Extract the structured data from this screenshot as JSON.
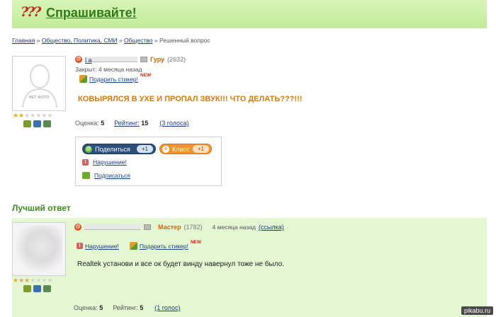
{
  "header": {
    "logo_mark": "???",
    "title": "Спрашивайте!"
  },
  "breadcrumb": {
    "items": [
      "Главная",
      "Общество, Политика, СМИ",
      "Общество"
    ],
    "separator": "»",
    "current": "Решенный вопрос"
  },
  "question": {
    "avatar_caption": "НЕТ ФОТО",
    "stars_filled": 2,
    "stars_total": 7,
    "user_name": "l                 а",
    "rank": "Гуру",
    "points": "(2632)",
    "closed": "Закрыт: 4 месяца назад",
    "gift_label": "Подарить стикер!",
    "new_badge": "NEW",
    "text": "КОВЫРЯЛСЯ В УХЕ И ПРОПАЛ ЗВУК!!! ЧТО ДЕЛАТЬ???!!!",
    "rating_label": "Оценка:",
    "rating_value": "5",
    "score_label": "Рейтинг:",
    "score_value": "15",
    "votes": "(3 голоса)"
  },
  "share": {
    "share_label": "Поделиться",
    "share_count": "+1",
    "class_label": "Класс",
    "class_count": "+1",
    "report_label": "Нарушение!",
    "subscribe_label": "Подписаться"
  },
  "best_answer": {
    "title": "Лучший ответ",
    "stars_filled": 3,
    "stars_total": 7,
    "user_name": "                  ",
    "rank": "Мастер",
    "points": "(1782)",
    "time": "4 месяца назад",
    "link_label": "(ссылка)",
    "report_label": "Нарушение!",
    "gift_label": "Подарить стикер!",
    "new_badge": "NEW",
    "text": "Realtek установи и все ок будет винду навернул тоже не было.",
    "rating_label": "Оценка:",
    "rating_value": "5",
    "score_label": "Рейтинг:",
    "score_value": "5",
    "votes": "(1 голос)"
  },
  "watermark": "pikabu.ru",
  "colors": {
    "header_green": "#c2ec98",
    "accent_orange": "#d27a12",
    "best_green": "#3f8a1e",
    "answer_bg": "#e3f7d3"
  }
}
